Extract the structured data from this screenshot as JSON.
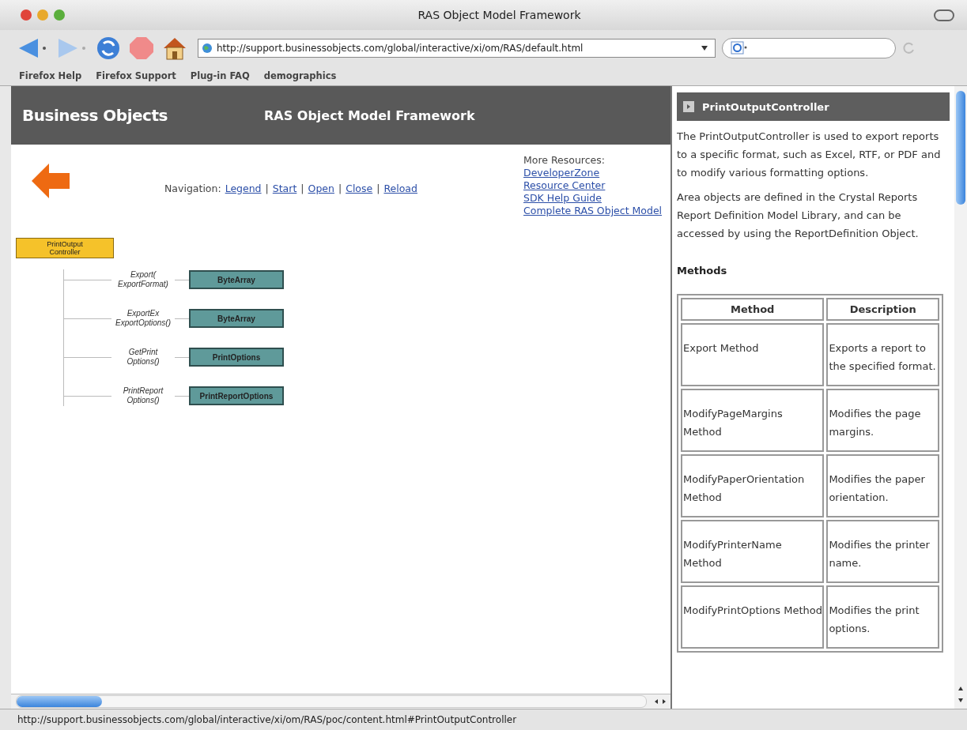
{
  "window": {
    "title": "RAS Object Model Framework"
  },
  "toolbar": {
    "url": "http://support.businessobjects.com/global/interactive/xi/om/RAS/default.html"
  },
  "bookmarks": [
    "Firefox Help",
    "Firefox Support",
    "Plug-in FAQ",
    "demographics"
  ],
  "banner": {
    "logo": "Business Objects",
    "title": "RAS Object Model Framework"
  },
  "navigation": {
    "label": "Navigation:",
    "separator": "|",
    "links": [
      "Legend",
      "Start",
      "Open",
      "Close",
      "Reload"
    ]
  },
  "resources": {
    "label": "More Resources:",
    "links": [
      "DeveloperZone",
      "Resource Center",
      "SDK Help Guide",
      "Complete RAS Object Model"
    ]
  },
  "diagram": {
    "root": "PrintOutput\nController",
    "methods": [
      {
        "label": "Export(\nExportFormat)",
        "returns": "ByteArray"
      },
      {
        "label": "ExportEx\nExportOptions()",
        "returns": "ByteArray"
      },
      {
        "label": "GetPrint\nOptions()",
        "returns": "PrintOptions"
      },
      {
        "label": "PrintReport\nOptions()",
        "returns": "PrintReportOptions"
      }
    ]
  },
  "panel": {
    "title": "PrintOutputController",
    "paragraphs": [
      "The PrintOutputController is used to export reports to a specific format, such as Excel, RTF, or PDF and to modify various formatting options.",
      "Area objects are defined in the Crystal Reports Report Definition Model Library, and can be accessed by using the ReportDefinition Object."
    ],
    "heading": "Methods",
    "table": {
      "columns": [
        "Method",
        "Description"
      ],
      "rows": [
        [
          "Export Method",
          "Exports a report to the specified format."
        ],
        [
          "ModifyPageMargins Method",
          "Modifies the page margins."
        ],
        [
          "ModifyPaperOrientation Method",
          "Modifies the paper orientation."
        ],
        [
          "ModifyPrinterName Method",
          "Modifies the printer name."
        ],
        [
          "ModifyPrintOptions Method",
          "Modifies the print options."
        ]
      ]
    }
  },
  "status_bar": {
    "text": "http://support.businessobjects.com/global/interactive/xi/om/RAS/poc/content.html#PrintOutputController"
  }
}
